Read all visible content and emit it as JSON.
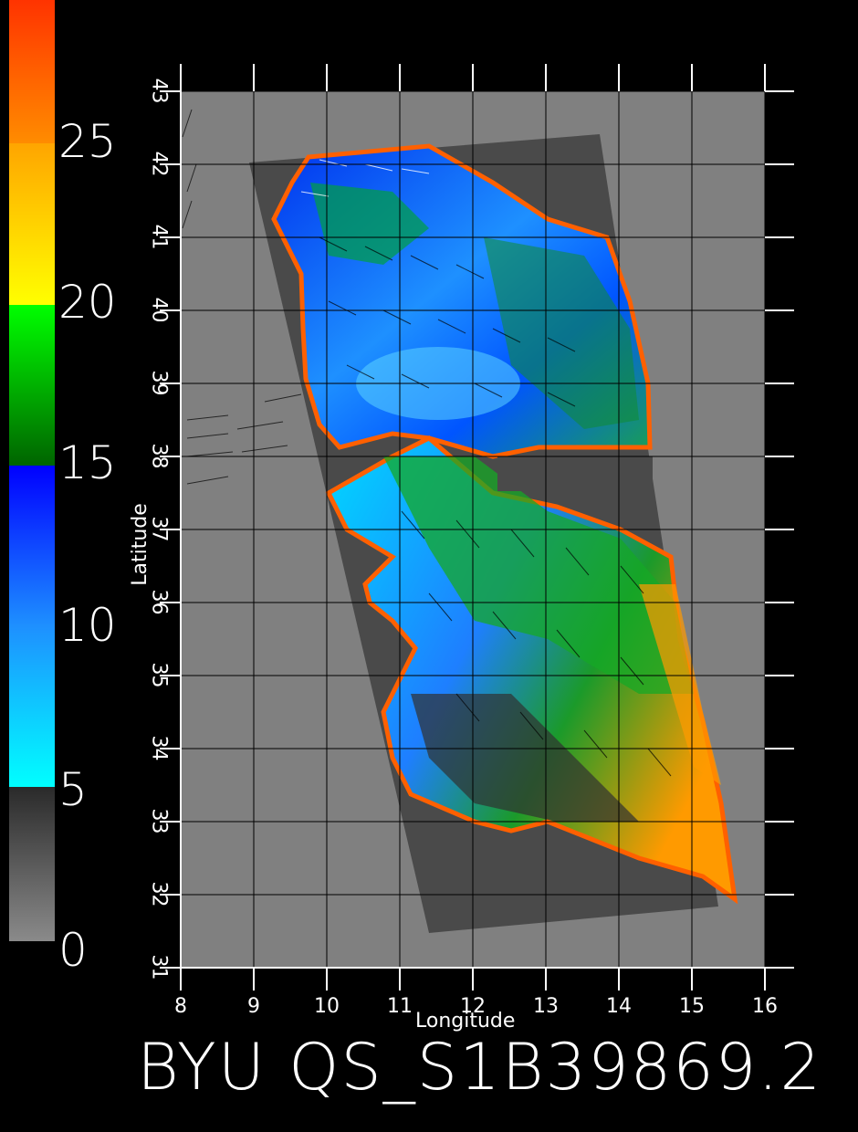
{
  "colorbar": {
    "labels": [
      "0",
      "5",
      "10",
      "15",
      "20",
      "25"
    ],
    "stops": [
      {
        "from": 0,
        "to": 5,
        "colors": [
          "#8a8a8a",
          "#303030"
        ]
      },
      {
        "from": 5,
        "to": 10,
        "colors": [
          "#00ffff",
          "#1e90ff"
        ]
      },
      {
        "from": 10,
        "to": 15,
        "colors": [
          "#1e90ff",
          "#0000ff"
        ]
      },
      {
        "from": 15,
        "to": 20,
        "colors": [
          "#006400",
          "#00ff00"
        ]
      },
      {
        "from": 20,
        "to": 25,
        "colors": [
          "#ffff00",
          "#ff8c00"
        ]
      },
      {
        "from": 25,
        "to": 30,
        "colors": [
          "#ff8c00",
          "#ff3300"
        ]
      }
    ]
  },
  "map": {
    "xlabel": "Longitude",
    "ylabel": "Latitude",
    "x_ticks": [
      "8",
      "9",
      "10",
      "11",
      "12",
      "13",
      "14",
      "15",
      "16"
    ],
    "y_ticks": [
      "31",
      "32",
      "33",
      "34",
      "35",
      "36",
      "37",
      "38",
      "39",
      "40",
      "41",
      "42",
      "43"
    ],
    "lon_range": [
      8,
      16
    ],
    "lat_range": [
      31,
      43
    ],
    "colors": {
      "background_land": "#808080",
      "swath": "#4a4a4a",
      "grid": "#000000",
      "axis": "#ffffff"
    }
  },
  "title": "BYU QS_S1B39869.2"
}
